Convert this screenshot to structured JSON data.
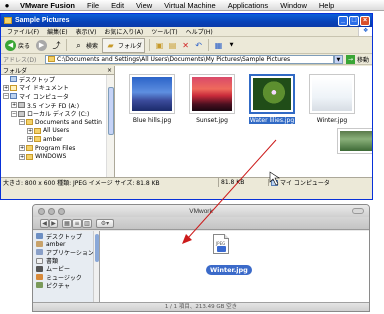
{
  "mac_menubar": {
    "apple": "",
    "items": [
      "VMware Fusion",
      "File",
      "Edit",
      "View",
      "Virtual Machine",
      "Applications",
      "Window",
      "Help"
    ]
  },
  "xp_window": {
    "title": "Sample Pictures",
    "menu": [
      "ファイル(F)",
      "編集(E)",
      "表示(V)",
      "お気に入り(A)",
      "ツール(T)",
      "ヘルプ(H)"
    ],
    "toolbar": {
      "back": "戻る",
      "search": "検索",
      "folders": "フォルダ"
    },
    "address": {
      "label": "アドレス(D)",
      "path": "C:\\Documents and Settings\\All Users\\Documents\\My Pictures\\Sample Pictures",
      "go": "移動"
    },
    "tree": {
      "header": "フォルダ",
      "close": "×",
      "items": [
        {
          "label": "デスクトップ",
          "expander": "",
          "icon": "desktop"
        },
        {
          "label": "マイ ドキュメント",
          "expander": "+",
          "icon": "docs"
        },
        {
          "label": "マイ コンピュータ",
          "expander": "−",
          "icon": "computer"
        },
        {
          "label": "3.5 インチ FD (A:)",
          "expander": "+",
          "icon": "drive"
        },
        {
          "label": "ローカル ディスク (C:)",
          "expander": "−",
          "icon": "drive"
        },
        {
          "label": "Documents and Settin",
          "expander": "−",
          "icon": "folder"
        },
        {
          "label": "All Users",
          "expander": "+",
          "icon": "folder"
        },
        {
          "label": "amber",
          "expander": "+",
          "icon": "folder"
        },
        {
          "label": "Program Files",
          "expander": "+",
          "icon": "folder"
        },
        {
          "label": "WINDOWS",
          "expander": "+",
          "icon": "folder"
        }
      ]
    },
    "files": [
      {
        "name": "Blue hills.jpg",
        "style": "blue",
        "selected": false
      },
      {
        "name": "Sunset.jpg",
        "style": "sunset",
        "selected": false
      },
      {
        "name": "Water lilies.jpg",
        "style": "lilies",
        "selected": true
      },
      {
        "name": "Winter.jpg",
        "style": "winter",
        "selected": false
      }
    ],
    "status": {
      "info": "大きさ: 800 x 600 種類: JPEG イメージ サイズ: 81.8 KB",
      "size": "81.8 KB",
      "location": "マイ コンピュータ"
    }
  },
  "finder_window": {
    "title": "VMwork",
    "sidebar": [
      {
        "label": "デスクトップ",
        "icon": "desk"
      },
      {
        "label": "amber",
        "icon": "home"
      },
      {
        "label": "アプリケーション",
        "icon": "app"
      },
      {
        "label": "書類",
        "icon": "doc"
      },
      {
        "label": "ムービー",
        "icon": "mov"
      },
      {
        "label": "ミュージック",
        "icon": "mus"
      },
      {
        "label": "ピクチャ",
        "icon": "pic"
      }
    ],
    "file": {
      "name": "Winter.jpg",
      "badge": "JPEG"
    },
    "status": "1 / 1 項目、213.49 GB 空き"
  },
  "colors": {
    "xp_title": "#0a5fd8",
    "selection": "#316ac5",
    "drag_line": "#cc1a1a",
    "finder_label": "#3b6ac9"
  }
}
